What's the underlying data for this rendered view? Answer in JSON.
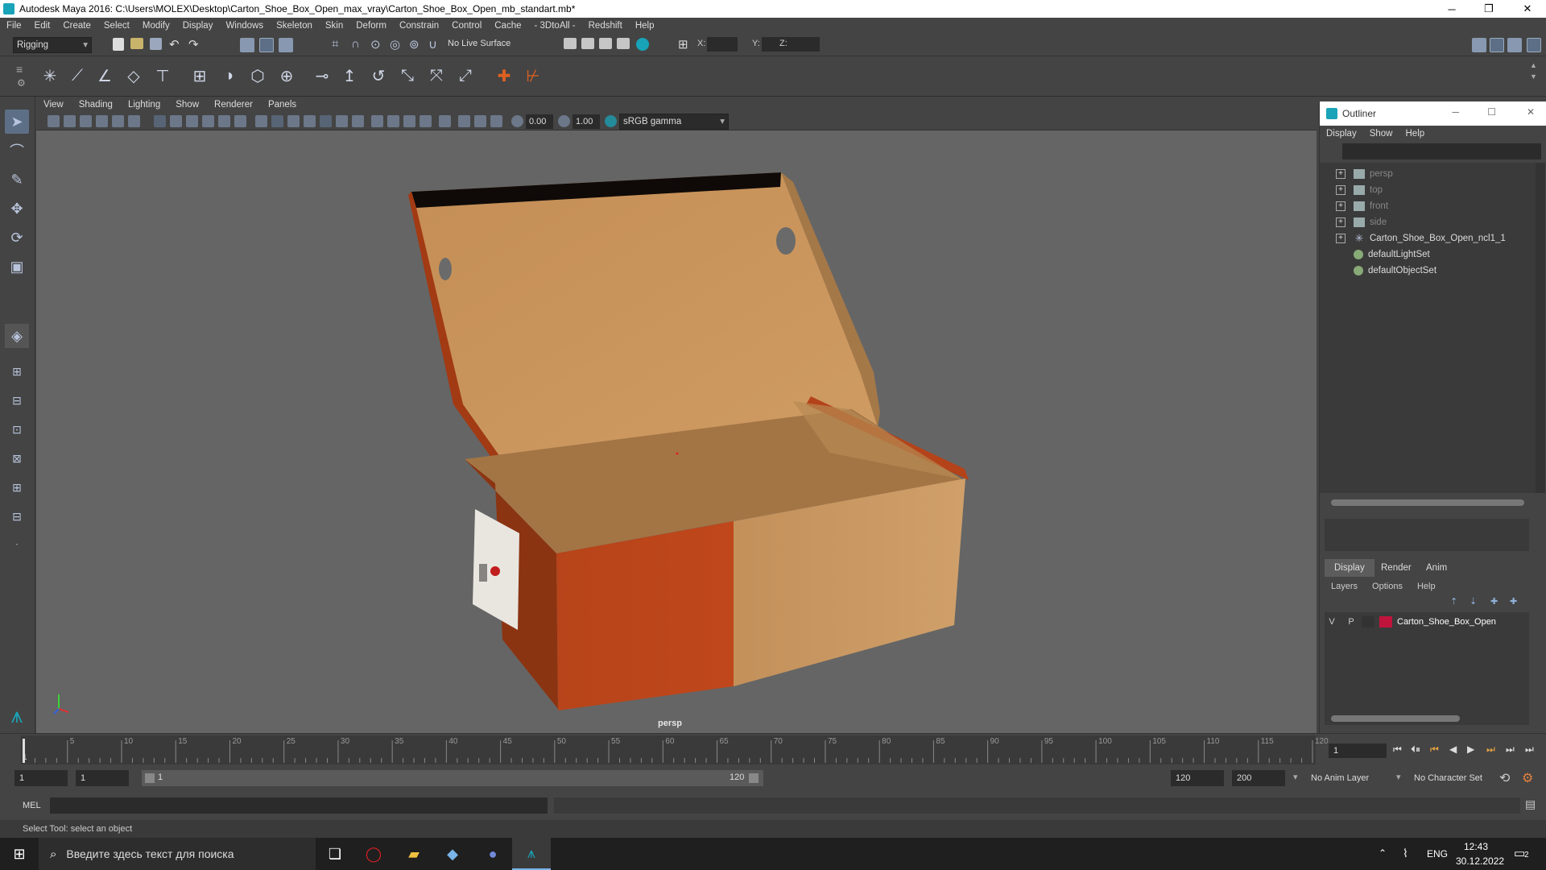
{
  "window": {
    "title": "Autodesk Maya 2016: C:\\Users\\MOLEX\\Desktop\\Carton_Shoe_Box_Open_max_vray\\Carton_Shoe_Box_Open_mb_standart.mb*",
    "minimize": "─",
    "restore": "❐",
    "close": "✕"
  },
  "menubar": [
    "File",
    "Edit",
    "Create",
    "Select",
    "Modify",
    "Display",
    "Windows",
    "Skeleton",
    "Skin",
    "Deform",
    "Constrain",
    "Control",
    "Cache",
    "- 3DtoAll -",
    "Redshift",
    "Help"
  ],
  "statusline": {
    "menuset": "Rigging",
    "live_surface": "No Live Surface",
    "x_label": "X:",
    "y_label": "Y:",
    "z_label": "Z:"
  },
  "viewport": {
    "menu": [
      "View",
      "Shading",
      "Lighting",
      "Show",
      "Renderer",
      "Panels"
    ],
    "exposure": "0.00",
    "gamma": "1.00",
    "colorspace": "sRGB gamma",
    "camera_label": "persp"
  },
  "outliner": {
    "title": "Outliner",
    "menu": [
      "Display",
      "Show",
      "Help"
    ],
    "items": [
      {
        "label": "persp",
        "type": "camera",
        "dim": true
      },
      {
        "label": "top",
        "type": "camera",
        "dim": true
      },
      {
        "label": "front",
        "type": "camera",
        "dim": true
      },
      {
        "label": "side",
        "type": "camera",
        "dim": true
      },
      {
        "label": "Carton_Shoe_Box_Open_ncl1_1",
        "type": "transform",
        "dim": false
      },
      {
        "label": "defaultLightSet",
        "type": "set",
        "dim": false
      },
      {
        "label": "defaultObjectSet",
        "type": "set",
        "dim": false
      }
    ]
  },
  "layers": {
    "tabs": [
      "Display",
      "Render",
      "Anim"
    ],
    "menu": [
      "Layers",
      "Options",
      "Help"
    ],
    "layer": {
      "v": "V",
      "p": "P",
      "name": "Carton_Shoe_Box_Open",
      "color": "#c0143c"
    }
  },
  "timeline": {
    "ticks": [
      "5",
      "10",
      "15",
      "20",
      "25",
      "30",
      "35",
      "40",
      "45",
      "50",
      "55",
      "60",
      "65",
      "70",
      "75",
      "80",
      "85",
      "90",
      "95",
      "100",
      "105",
      "110",
      "115",
      "120"
    ],
    "start_tick": "1",
    "current_frame": "1"
  },
  "range": {
    "start": "1",
    "playback_start": "1",
    "slider_start": "1",
    "slider_end": "120",
    "playback_end": "120",
    "end": "200",
    "anim_layer": "No Anim Layer",
    "char_set": "No Character Set"
  },
  "cmdline": {
    "label": "MEL"
  },
  "helpline": "Select Tool: select an object",
  "taskbar": {
    "search_placeholder": "Введите здесь текст для поиска",
    "lang": "ENG",
    "time": "12:43",
    "date": "30.12.2022",
    "notif_count": "2"
  },
  "colors": {
    "accent": "#5d6f86",
    "maya_teal": "#19a3b8",
    "box_orange": "#b8461a",
    "box_cardboard": "#c9955c"
  }
}
